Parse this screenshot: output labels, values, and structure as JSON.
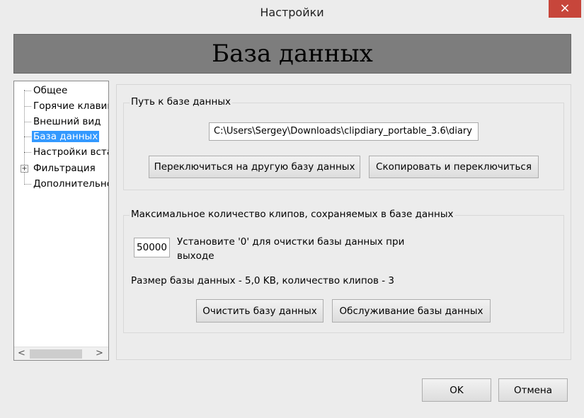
{
  "window": {
    "title": "Настройки",
    "close_symbol": "×"
  },
  "header": {
    "title": "База данных"
  },
  "tree": {
    "items": [
      {
        "label": "Общее",
        "selected": false
      },
      {
        "label": "Горячие клавиш",
        "selected": false
      },
      {
        "label": "Внешний вид",
        "selected": false
      },
      {
        "label": "База данных",
        "selected": true
      },
      {
        "label": "Настройки вста",
        "selected": false
      },
      {
        "label": "Фильтрация",
        "selected": false
      },
      {
        "label": "Дополнительно",
        "selected": false
      }
    ],
    "expander_symbol": "+",
    "scroll_left": "<",
    "scroll_right": ">"
  },
  "db_path": {
    "group_title": "Путь к базе данных",
    "path_value": "C:\\Users\\Sergey\\Downloads\\clipdiary_portable_3.6\\diary",
    "switch_button": "Переключиться на другую базу данных",
    "copy_button": "Скопировать и переключиться"
  },
  "max_clips": {
    "group_title": "Максимальное количество клипов, сохраняемых в базе данных",
    "value": "50000",
    "hint": "Установите '0' для очистки базы данных при выходе",
    "size_info": "Размер базы данных - 5,0 KB, количество клипов - 3",
    "clear_button": "Очистить базу данных",
    "maintenance_button": "Обслуживание базы данных"
  },
  "footer": {
    "ok_button": "OK",
    "cancel_button": "Отмена"
  }
}
